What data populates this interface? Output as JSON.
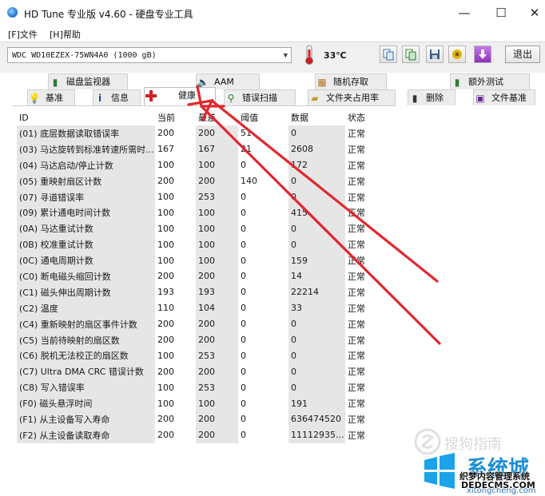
{
  "window": {
    "title": "HD Tune 专业版 v4.60 - 硬盘专业工具",
    "minimize": "—",
    "maximize": "☐",
    "close": "✕"
  },
  "menu": {
    "file": "[F]文件",
    "help": "[H]帮助"
  },
  "toolbar": {
    "drive": "WDC WD10EZEX-75WN4A0 (1000 gB)",
    "temperature": "33℃",
    "exit_label": "退出",
    "icons": [
      "copy-icon",
      "copy-screen-icon",
      "save-icon",
      "options-icon",
      "download-icon"
    ]
  },
  "tabs_top": [
    {
      "label": "磁盘监视器",
      "icon": "disk-monitor-icon"
    },
    {
      "label": "AAM",
      "icon": "speaker-icon"
    },
    {
      "label": "随机存取",
      "icon": "random-access-icon"
    },
    {
      "label": "额外测试",
      "icon": "extra-tests-icon"
    }
  ],
  "tabs_bottom": [
    {
      "label": "基准",
      "icon": "benchmark-icon"
    },
    {
      "label": "信息",
      "icon": "info-icon"
    },
    {
      "label": "健康",
      "icon": "health-cross-icon"
    },
    {
      "label": "错误扫描",
      "icon": "magnifier-icon"
    },
    {
      "label": "文件夹占用率",
      "icon": "folder-icon"
    },
    {
      "label": "删除",
      "icon": "trash-icon"
    },
    {
      "label": "文件基准",
      "icon": "file-benchmark-icon"
    }
  ],
  "active_tab": "健康",
  "table": {
    "headers": [
      "ID",
      "当前",
      "最差",
      "阈值",
      "数据",
      "状态"
    ],
    "rows": [
      [
        "(01) 底层数据读取错误率",
        "200",
        "200",
        "51",
        "0",
        "正常"
      ],
      [
        "(03) 马达旋转到标准转速所需时...",
        "167",
        "167",
        "21",
        "2608",
        "正常"
      ],
      [
        "(04) 马达启动/停止计数",
        "100",
        "100",
        "0",
        "172",
        "正常"
      ],
      [
        "(05) 重映射扇区计数",
        "200",
        "200",
        "140",
        "0",
        "正常"
      ],
      [
        "(07) 寻道错误率",
        "100",
        "253",
        "0",
        "0",
        "正常"
      ],
      [
        "(09) 累计通电时间计数",
        "100",
        "100",
        "0",
        "415",
        "正常"
      ],
      [
        "(0A) 马达重试计数",
        "100",
        "100",
        "0",
        "0",
        "正常"
      ],
      [
        "(0B) 校准重试计数",
        "100",
        "100",
        "0",
        "0",
        "正常"
      ],
      [
        "(0C) 通电周期计数",
        "100",
        "100",
        "0",
        "159",
        "正常"
      ],
      [
        "(C0) 断电磁头缩回计数",
        "200",
        "200",
        "0",
        "14",
        "正常"
      ],
      [
        "(C1) 磁头伸出周期计数",
        "193",
        "193",
        "0",
        "22214",
        "正常"
      ],
      [
        "(C2) 温度",
        "110",
        "104",
        "0",
        "33",
        "正常"
      ],
      [
        "(C4) 重新映射的扇区事件计数",
        "200",
        "200",
        "0",
        "0",
        "正常"
      ],
      [
        "(C5) 当前待映射的扇区数",
        "200",
        "200",
        "0",
        "0",
        "正常"
      ],
      [
        "(C6) 脱机无法校正的扇区数",
        "100",
        "253",
        "0",
        "0",
        "正常"
      ],
      [
        "(C7) Ultra DMA CRC 错误计数",
        "200",
        "200",
        "0",
        "0",
        "正常"
      ],
      [
        "(C8) 写入错误率",
        "100",
        "253",
        "0",
        "0",
        "正常"
      ],
      [
        "(F0) 磁头悬浮时间",
        "100",
        "100",
        "0",
        "191",
        "正常"
      ],
      [
        "(F1) 从主设备写入寿命",
        "200",
        "200",
        "0",
        "636474520",
        "正常"
      ],
      [
        "(F2) 从主设备读取寿命",
        "200",
        "200",
        "0",
        "11112935...",
        "正常"
      ]
    ]
  },
  "watermarks": {
    "sogou": "搜狗指南",
    "site_name": "系统城",
    "site_url": "xitongcheng.com",
    "dede_title": "织梦内容管理系统",
    "dede_url": "DEDECMS.COM"
  },
  "colors": {
    "arrow": "#e0282e",
    "shaded_column": "#e6e6e6",
    "health_cross": "#d42020"
  }
}
